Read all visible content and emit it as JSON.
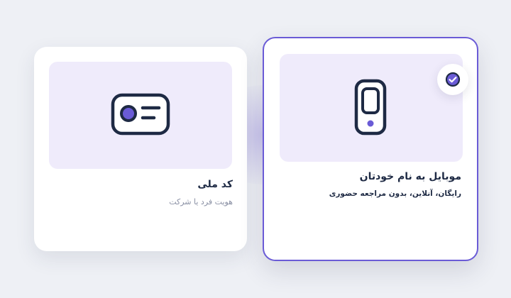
{
  "options": [
    {
      "title": "کد ملی",
      "subtitle": "هویت فرد یا شرکت",
      "icon": "id-card-icon",
      "selected": false
    },
    {
      "title": "موبایل به نام خودتان",
      "subtitle": "رایگان، آنلاین، بدون مراجعه حضوری",
      "icon": "mobile-phone-icon",
      "selected": true
    }
  ],
  "colors": {
    "accent": "#6a5bd6",
    "media_background": "#efebfb",
    "icon_stroke": "#1e2a44",
    "page_background": "#eef0f5"
  }
}
